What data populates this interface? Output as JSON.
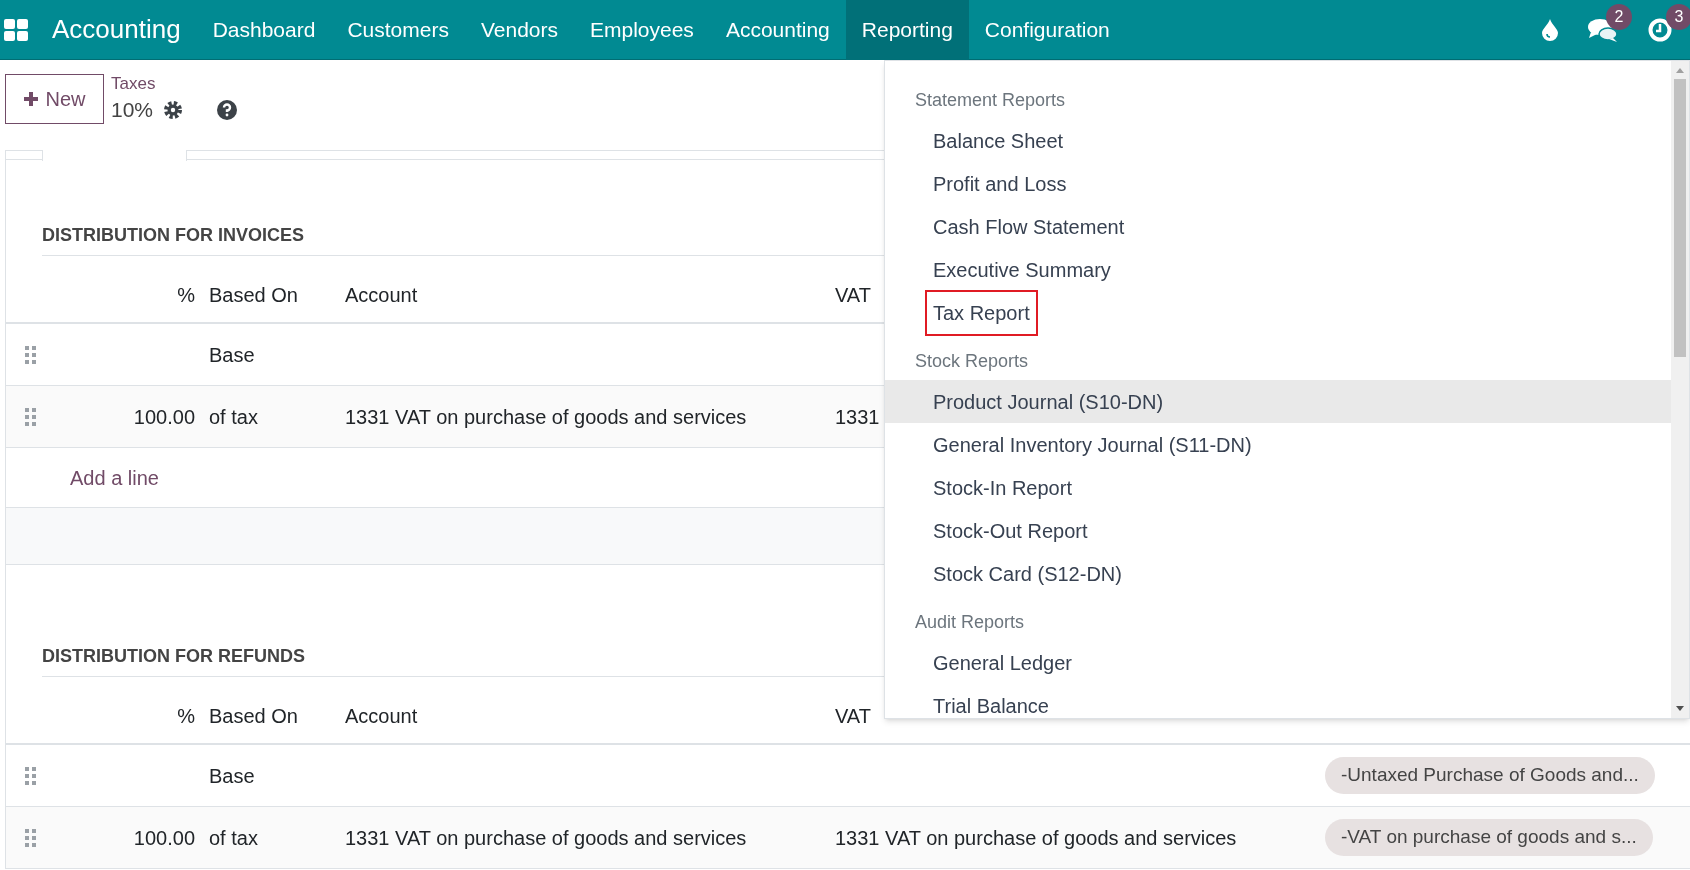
{
  "navbar": {
    "app_name": "Accounting",
    "menus": [
      {
        "label": "Dashboard",
        "selected": false
      },
      {
        "label": "Customers",
        "selected": false
      },
      {
        "label": "Vendors",
        "selected": false
      },
      {
        "label": "Employees",
        "selected": false
      },
      {
        "label": "Accounting",
        "selected": false
      },
      {
        "label": "Reporting",
        "selected": true
      },
      {
        "label": "Configuration",
        "selected": false
      }
    ],
    "messages_badge": "2",
    "activities_badge": "3"
  },
  "control_panel": {
    "new_button": "New",
    "breadcrumb": "Taxes",
    "record_title": "10%"
  },
  "sections": [
    {
      "title": "DISTRIBUTION FOR INVOICES",
      "columns": [
        "%",
        "Based On",
        "Account",
        "VAT"
      ],
      "rows": [
        {
          "based_on": "Base"
        },
        {
          "percent": "100.00",
          "based_on": "of tax",
          "account": "1331 VAT on purchase of goods and services",
          "counterpart": "1331"
        }
      ],
      "add_line": "Add a line"
    },
    {
      "title": "DISTRIBUTION FOR REFUNDS",
      "columns": [
        "%",
        "Based On",
        "Account",
        "VAT"
      ],
      "rows": [
        {
          "based_on": "Base",
          "tax_grid": "-Untaxed Purchase of Goods and..."
        },
        {
          "percent": "100.00",
          "based_on": "of tax",
          "account": "1331 VAT on purchase of goods and services",
          "counterpart": "1331 VAT on purchase of goods and services",
          "tax_grid": "-VAT on purchase of goods and s..."
        }
      ]
    }
  ],
  "dropdown": {
    "groups": [
      {
        "title": "Statement Reports",
        "items": [
          {
            "label": "Balance Sheet",
            "hovered": false,
            "outlined": false
          },
          {
            "label": "Profit and Loss",
            "hovered": false,
            "outlined": false
          },
          {
            "label": "Cash Flow Statement",
            "hovered": false,
            "outlined": false
          },
          {
            "label": "Executive Summary",
            "hovered": false,
            "outlined": false
          },
          {
            "label": "Tax Report",
            "hovered": false,
            "outlined": true
          }
        ]
      },
      {
        "title": "Stock Reports",
        "items": [
          {
            "label": "Product Journal (S10-DN)",
            "hovered": true,
            "outlined": false
          },
          {
            "label": "General Inventory Journal (S11-DN)",
            "hovered": false,
            "outlined": false
          },
          {
            "label": "Stock-In Report",
            "hovered": false,
            "outlined": false
          },
          {
            "label": "Stock-Out Report",
            "hovered": false,
            "outlined": false
          },
          {
            "label": "Stock Card (S12-DN)",
            "hovered": false,
            "outlined": false
          }
        ]
      },
      {
        "title": "Audit Reports",
        "items": [
          {
            "label": "General Ledger",
            "hovered": false,
            "outlined": false
          },
          {
            "label": "Trial Balance",
            "hovered": false,
            "outlined": false
          }
        ]
      }
    ]
  }
}
